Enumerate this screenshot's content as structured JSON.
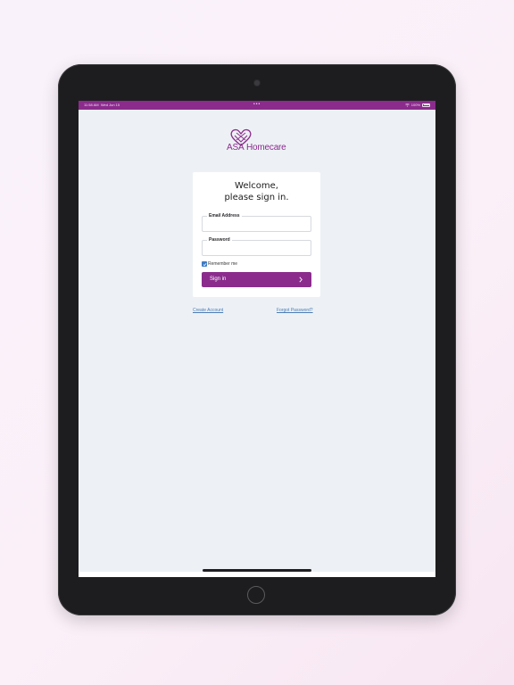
{
  "status_bar": {
    "time": "11:58 AM",
    "date": "Wed Jun 15",
    "battery": "100%"
  },
  "brand": {
    "name_part1": "ASA",
    "name_part2": "Homecare",
    "color": "#8b2c8d"
  },
  "login": {
    "heading_line1": "Welcome,",
    "heading_line2": "please sign in.",
    "email_label": "Email Address",
    "email_value": "",
    "password_label": "Password",
    "password_value": "",
    "remember_label": "Remember me",
    "remember_checked": true,
    "sign_in_label": "Sign in"
  },
  "links": {
    "create_account": "Create Account",
    "forgot_password": "Forgot Password?"
  },
  "colors": {
    "accent": "#8b2c8d",
    "link": "#4b7cb6",
    "checkbox": "#3f7cc4",
    "screen_bg": "#edf1f5"
  }
}
